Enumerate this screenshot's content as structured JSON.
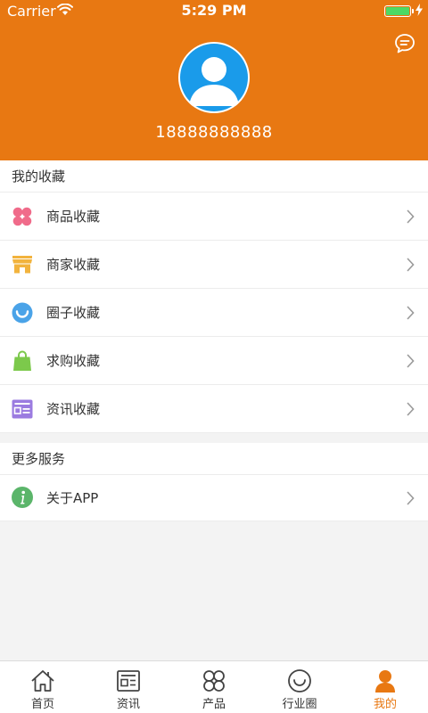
{
  "status_bar": {
    "carrier": "Carrier",
    "time": "5:29 PM",
    "battery_level": 1.0
  },
  "profile": {
    "phone": "18888888888",
    "message_icon": "chat-bubble-icon",
    "avatar_icon": "person-avatar-icon"
  },
  "favorites": {
    "title": "我的收藏",
    "items": [
      {
        "label": "商品收藏",
        "icon": "clover-icon",
        "color": "#f06b8a"
      },
      {
        "label": "商家收藏",
        "icon": "shop-icon",
        "color": "#f2b33d"
      },
      {
        "label": "圈子收藏",
        "icon": "smile-circle-icon",
        "color": "#4aa3e8"
      },
      {
        "label": "求购收藏",
        "icon": "shopping-bag-icon",
        "color": "#7cc94b"
      },
      {
        "label": "资讯收藏",
        "icon": "news-card-icon",
        "color": "#9b7be0"
      }
    ]
  },
  "more": {
    "title": "更多服务",
    "items": [
      {
        "label": "关于APP",
        "icon": "info-icon",
        "color": "#5bb56a"
      }
    ]
  },
  "tabbar": {
    "active_color": "#e87812",
    "tabs": [
      {
        "label": "首页",
        "icon": "home-icon"
      },
      {
        "label": "资讯",
        "icon": "news-icon"
      },
      {
        "label": "产品",
        "icon": "product-grid-icon"
      },
      {
        "label": "行业圈",
        "icon": "smile-circle-icon"
      },
      {
        "label": "我的",
        "icon": "person-icon",
        "active": true
      }
    ]
  },
  "theme": {
    "brand": "#e87812"
  }
}
